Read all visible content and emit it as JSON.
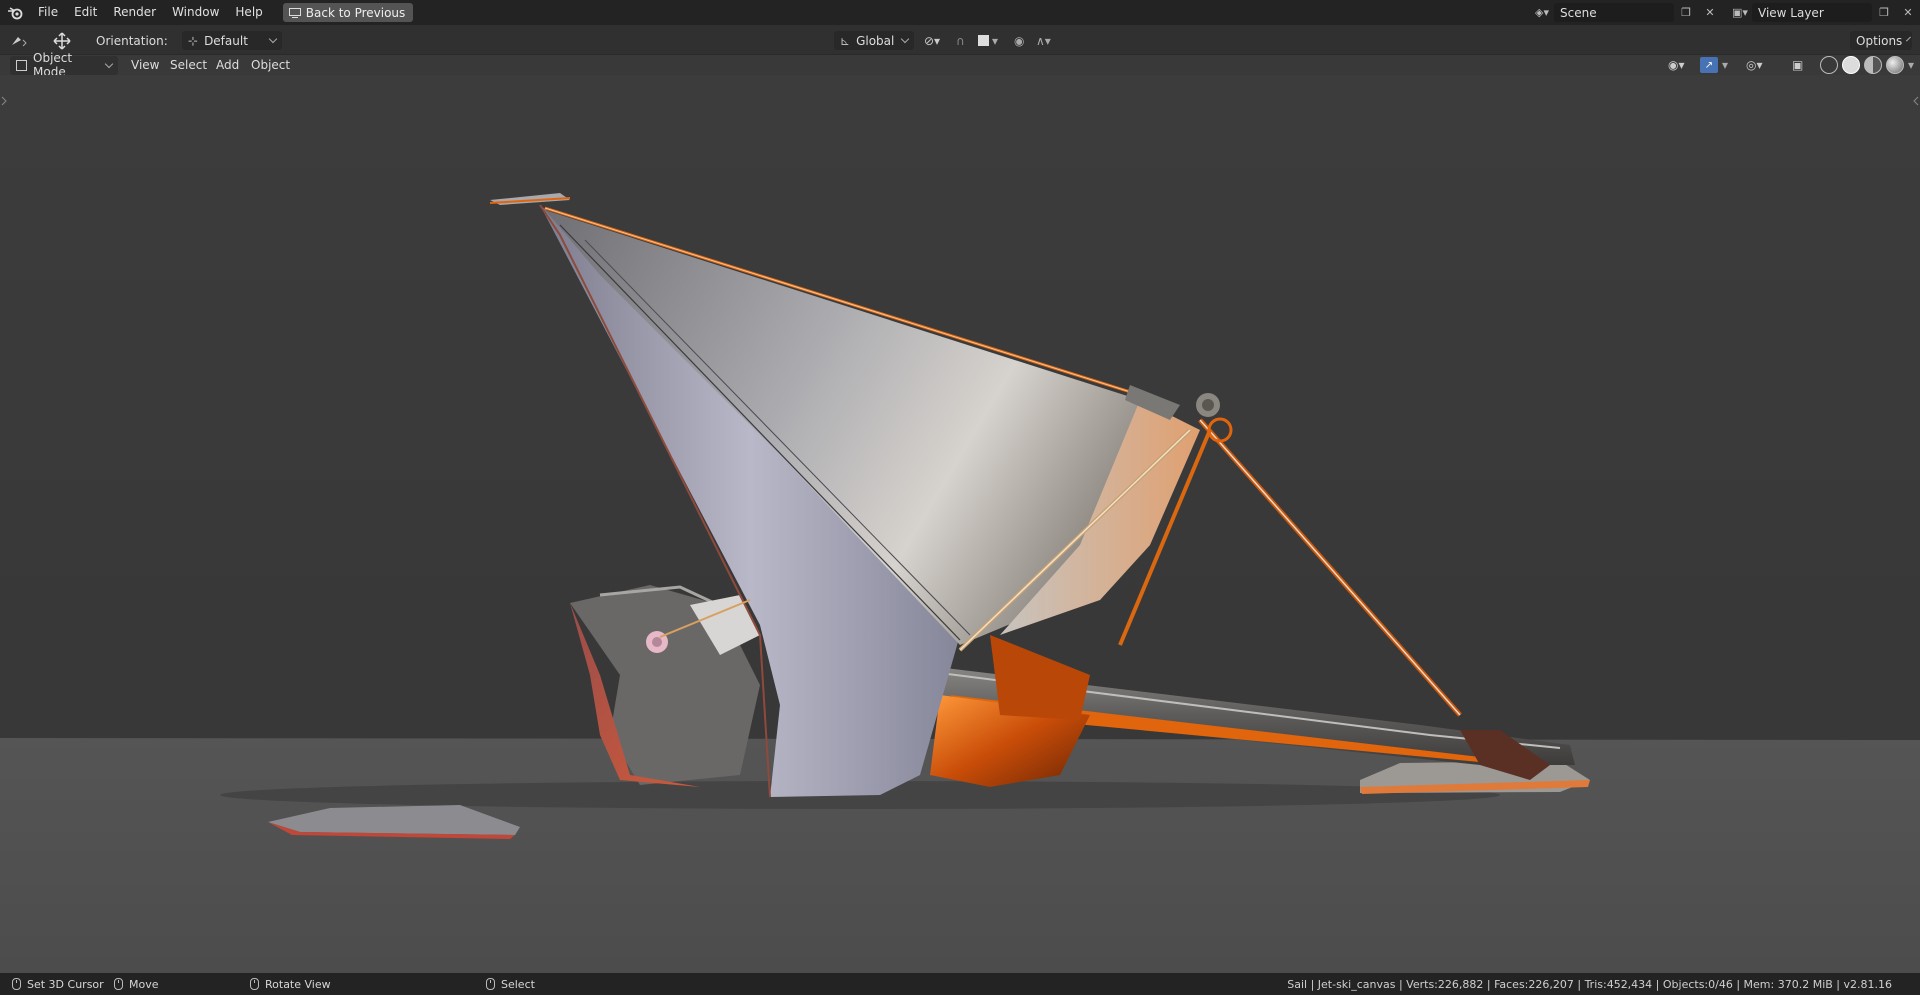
{
  "menubar": {
    "items": [
      "File",
      "Edit",
      "Render",
      "Window",
      "Help"
    ],
    "back_button": "Back to Previous",
    "scene_name": "Scene",
    "view_layer": "View Layer"
  },
  "toolheader": {
    "orientation_label": "Orientation:",
    "orientation_value": "Default",
    "transform_space": "Global",
    "options_label": "Options"
  },
  "viewport_header": {
    "mode": "Object Mode",
    "menus": [
      "View",
      "Select",
      "Add",
      "Object"
    ]
  },
  "statusbar": {
    "cursor_action": "Set 3D Cursor",
    "move_action": "Move",
    "rotate_action": "Rotate View",
    "select_action": "Select",
    "stats": "Sail | Jet-ski_canvas | Verts:226,882 | Faces:226,207 | Tris:452,434 | Objects:0/46 | Mem: 370.2 MiB | v2.81.16"
  },
  "colors": {
    "topbar": "#232323",
    "header": "#303030",
    "viewport_bg": "#393939",
    "accent_orange": "#e0650c"
  }
}
